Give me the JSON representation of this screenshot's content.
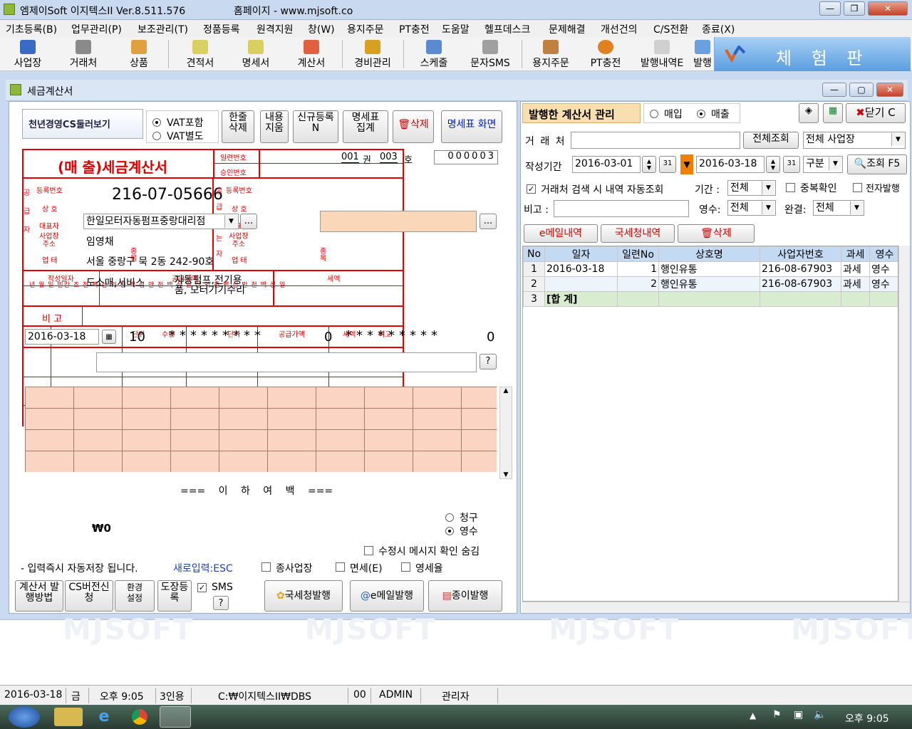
{
  "window": {
    "title": "엠제이Soft 이지텍스II Ver.8.511.576",
    "homepage": "홈페이지 - www.mjsoft.co"
  },
  "menu": [
    "기초등록(B)",
    "업무관리(P)",
    "보조관리(T)",
    "정품등록",
    "원격지원",
    "창(W)",
    "용지주문",
    "PT충전",
    "도움말",
    "헬프데스크",
    "문제해결",
    "개선건의",
    "C/S전환",
    "종료(X)"
  ],
  "toolbar": [
    "사업장",
    "거래처",
    "상품",
    "견적서",
    "명세서",
    "계산서",
    "경비관리",
    "스케줄",
    "문자SMS",
    "용지주문",
    "PT충전",
    "발행내역E",
    "발행"
  ],
  "trial_label": "체 험 판",
  "child_title": "세금계산서",
  "left": {
    "banner": "천년경영CS둘러보기",
    "vat_included": "VAT포함",
    "vat_separate": "VAT별도",
    "btn_line_delete": "한줄\n삭제",
    "btn_clear": "내용\n지움",
    "btn_new": "신규등록\nN",
    "btn_sum": "명세표\n집계",
    "btn_delete": "삭제",
    "btn_spec_screen": "명세표 화면",
    "invoice_title": "(매 출)세금계산서",
    "labels": {
      "serial": "일련번호",
      "approval": "승인번호",
      "regno": "등록번호",
      "company": "상 호",
      "ceo": "대표자",
      "address": "사업장\n주소",
      "biztype": "업 태",
      "item": "종목",
      "supplier": "공급자",
      "receiver": "공급받는자",
      "date_written": "작성일자",
      "supply_amount": "공급가액",
      "tax_amount": "세액",
      "remark": "비 고",
      "unit": "단위",
      "qty": "수량",
      "price": "단가",
      "row_supply": "공급가액",
      "row_tax": "세액",
      "row_remark": "비고"
    },
    "book_no": "001",
    "book_label": "권",
    "ho_no": "003",
    "ho_label": "호",
    "serial_no": "000003",
    "supplier_regno": "216-07-05666",
    "supplier_company": "한일모터자동펌프중랑대리점",
    "supplier_ceo": "임영채",
    "supplier_address": "서울 중랑구 묵 2동 242-90호",
    "overlap1": "도소매,서비스",
    "overlap2": "자동펌프,전기용품, 모터기기수리",
    "date_digits": "년 월 일 빈칸 조 천 백 십 억 천 백 십 만 천 백 십 일 십 억 천 백 십 만 천 백 십 일",
    "row_date": "2016-03-18",
    "row_blank": "10",
    "row_supply": "0",
    "row_tax": "0",
    "blank_text": "=== 이 하 여 백 ===",
    "total": "₩0",
    "claim": "청구",
    "receipt": "영수",
    "hide_msg": "수정시 메시지 확인 숨김",
    "auto_save": "- 입력즉시 자동저장 됩니다.",
    "new_input": "새로입력:ESC",
    "sub_workplace": "종사업장",
    "tax_free": "면세(E)",
    "zero_rate": "영세율",
    "btn_issue_method": "계산서 발\n행방법",
    "btn_cs_apply": "CS버전신\n청",
    "btn_env": "환경\n설정",
    "btn_stamp": "도장등\n록",
    "sms": "SMS",
    "q": "?",
    "btn_nts": "국세청발행",
    "btn_email": "e메일발행",
    "btn_paper": "종이발행"
  },
  "right": {
    "header": "발행한 계산서 관리",
    "buy": "매입",
    "sell": "매출",
    "btn_close": "닫기 C",
    "customer_label": "거 래 처",
    "btn_all": "전체조회",
    "workplace": "전체 사업장",
    "period_label": "작성기간",
    "from": "2016-03-01",
    "to": "2016-03-18",
    "gubun": "구분",
    "btn_search": "조회 F5",
    "auto_search": "거래처 검색 시 내역 자동조회",
    "term_label": "기간 :",
    "term": "전체",
    "dup": "중복확인",
    "e_issue": "전자발행",
    "remark_label": "비고 :",
    "receipt_label": "영수:",
    "receipt": "전체",
    "done_label": "완결:",
    "done": "전체",
    "tab_email": "e메일내역",
    "tab_nts": "국세청내역",
    "tab_delete": "삭제",
    "columns": [
      "No",
      "일자",
      "일련No",
      "상호명",
      "사업자번호",
      "과세",
      "영수"
    ],
    "rows": [
      [
        "1",
        "2016-03-18",
        "1",
        "행인유통",
        "216-08-67903",
        "과세",
        "영수"
      ],
      [
        "2",
        "",
        "2",
        "행인유통",
        "216-08-67903",
        "과세",
        "영수"
      ],
      [
        "3",
        "[합 계]",
        "",
        "",
        "",
        "",
        ""
      ]
    ]
  },
  "status": {
    "date": "2016-03-18",
    "day": "금",
    "time": "오후 9:05",
    "users": "3인용",
    "path": "C:₩이지텍스II₩DBS",
    "code": "00",
    "user": "ADMIN",
    "role": "관리자"
  },
  "watermark": "MJSOFT",
  "taskbar": {
    "clock": "오후 9:05"
  }
}
